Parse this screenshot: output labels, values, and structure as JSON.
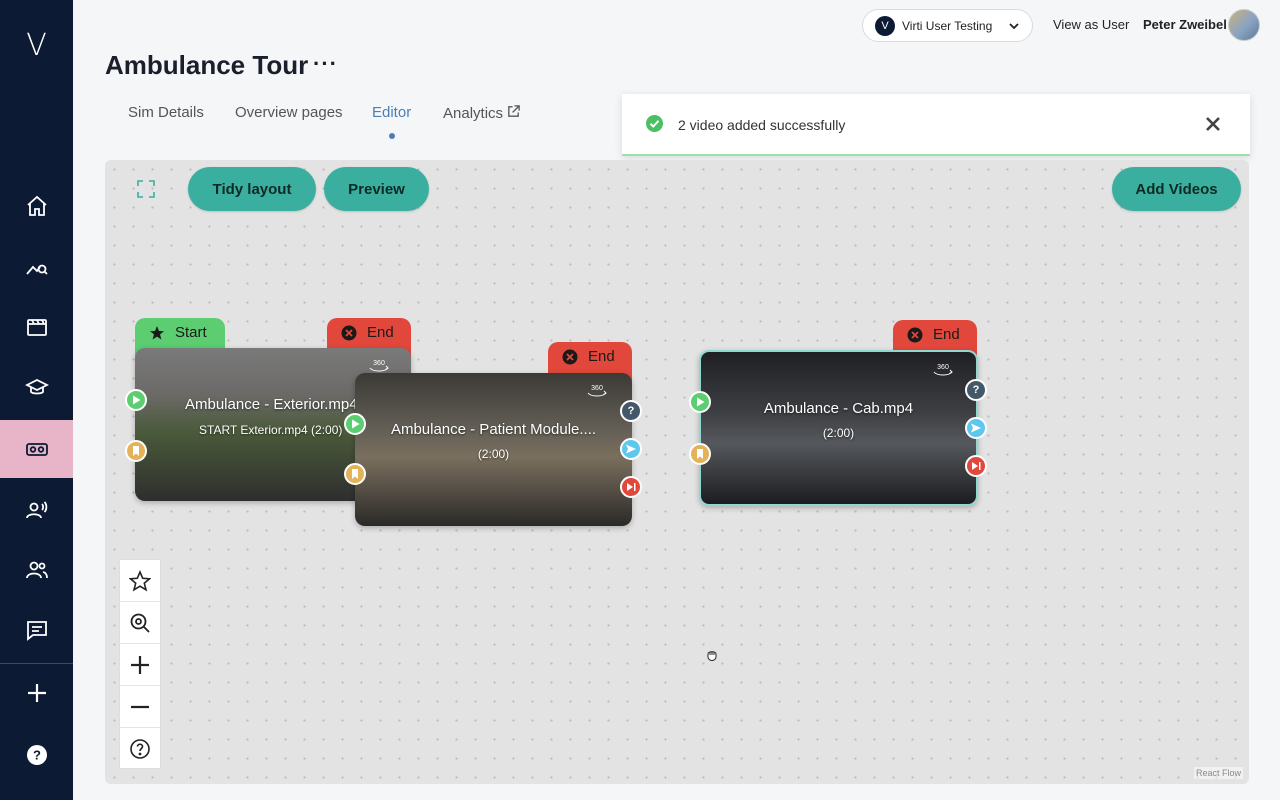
{
  "app": {
    "logo": "V"
  },
  "sidebar": {
    "items": [
      {
        "icon": "home-icon",
        "active": false
      },
      {
        "icon": "analytics-icon",
        "active": false
      },
      {
        "icon": "video-icon",
        "active": false
      },
      {
        "icon": "courses-icon",
        "active": false
      },
      {
        "icon": "vr-headset-icon",
        "active": true
      },
      {
        "icon": "voice-icon",
        "active": false
      },
      {
        "icon": "users-icon",
        "active": false
      },
      {
        "icon": "feedback-icon",
        "active": false
      }
    ],
    "add_icon": "plus-icon",
    "help_icon": "help-icon"
  },
  "topbar": {
    "org_logo": "V",
    "org_name": "Virti User Testing",
    "view_as": "View as User",
    "user_name": "Peter Zweibel"
  },
  "header": {
    "title": "Ambulance Tour",
    "more": "···",
    "tabs": [
      {
        "label": "Sim Details",
        "active": false
      },
      {
        "label": "Overview pages",
        "active": false
      },
      {
        "label": "Editor",
        "active": true
      },
      {
        "label": "Analytics",
        "active": false,
        "external": true
      }
    ]
  },
  "toast": {
    "message": "2 video added successfully"
  },
  "toolbar": {
    "tidy_label": "Tidy layout",
    "preview_label": "Preview",
    "add_videos_label": "Add Videos"
  },
  "nodes": [
    {
      "tag": "Start",
      "title": "Ambulance - Exterior.mp4",
      "subtitle": "START Exterior.mp4   (2:00)",
      "badge": "360"
    },
    {
      "tag": "End",
      "title": "Ambulance - Patient Module....",
      "subtitle": "(2:00)",
      "badge": "360"
    },
    {
      "tag": "End",
      "title": "Ambulance - Cab.mp4",
      "subtitle": "(2:00)",
      "badge": "360"
    }
  ],
  "node1_end_tag": "End",
  "attribution": "React Flow",
  "colors": {
    "sidebar_bg": "#0c1a33",
    "sidebar_active": "#e8b4c8",
    "accent_teal": "#3aaf9f",
    "tab_active": "#4a7fb5",
    "start_green": "#5ccd71",
    "end_red": "#e2473b",
    "success": "#4cbf63"
  }
}
